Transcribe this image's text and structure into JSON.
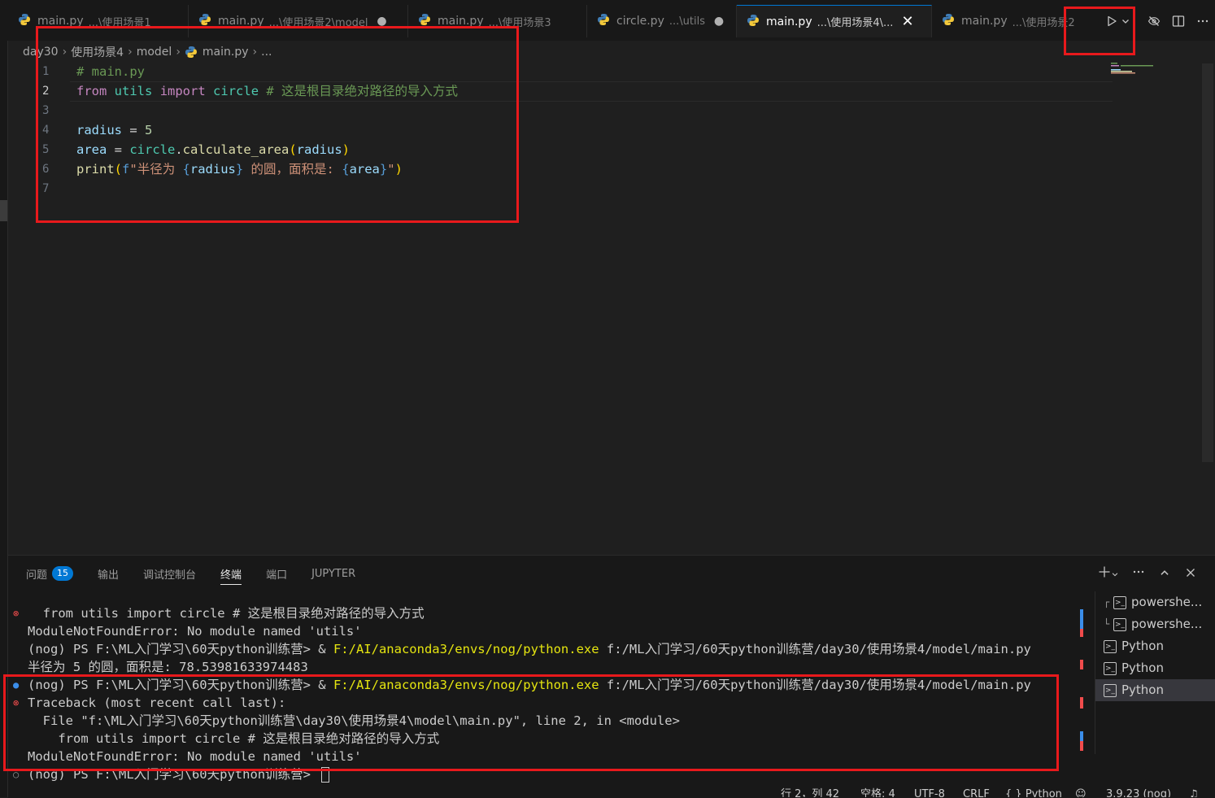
{
  "tabs": [
    {
      "name": "main.py",
      "desc": "...\\使用场景1",
      "mark": ""
    },
    {
      "name": "main.py",
      "desc": "...\\使用场景2\\model",
      "mark": "●"
    },
    {
      "name": "main.py",
      "desc": "...\\使用场景3",
      "mark": ""
    },
    {
      "name": "circle.py",
      "desc": "...\\utils",
      "mark": "●"
    },
    {
      "name": "main.py",
      "desc": "...\\使用场景4\\...",
      "mark": "✕"
    },
    {
      "name": "main.py",
      "desc": "...\\使用场景2",
      "mark": ""
    }
  ],
  "breadcrumb": {
    "items": [
      "day30",
      "使用场景4",
      "model"
    ],
    "file": "main.py",
    "tail": "..."
  },
  "editor": {
    "line_numbers": [
      "1",
      "2",
      "3",
      "4",
      "5",
      "6",
      "7"
    ],
    "current_line": "2",
    "code": {
      "l1": "# main.py",
      "l2_from": "from",
      "l2_module": "utils",
      "l2_import": "import",
      "l2_name": "circle",
      "l2_comment": "# 这是根目录绝对路径的导入方式",
      "l4_var": "radius",
      "l4_eq": " = ",
      "l4_num": "5",
      "l5_var": "area",
      "l5_eq": " = ",
      "l5_obj": "circle",
      "l5_dot": ".",
      "l5_fn": "calculate_area",
      "l5_open": "(",
      "l5_arg": "radius",
      "l5_close": ")",
      "l6_fn": "print",
      "l6_open": "(",
      "l6_fpre": "f",
      "l6_str1": "\"半径为 ",
      "l6_b1o": "{",
      "l6_v1": "radius",
      "l6_b1c": "}",
      "l6_str2": " 的圆，面积是: ",
      "l6_b2o": "{",
      "l6_v2": "area",
      "l6_b2c": "}",
      "l6_str3": "\"",
      "l6_close": ")"
    }
  },
  "panel": {
    "tabs": [
      {
        "label": "问题",
        "badge": "15"
      },
      {
        "label": "输出"
      },
      {
        "label": "调试控制台"
      },
      {
        "label": "终端"
      },
      {
        "label": "端口"
      },
      {
        "label": "JUPYTER"
      }
    ],
    "active_tab": "终端",
    "terminal_lines": {
      "t1": "  from utils import circle # 这是根目录绝对路径的导入方式",
      "t2": "ModuleNotFoundError: No module named 'utils'",
      "t3_prompt": "(nog) PS F:\\ML入门学习\\60天python训练营> & ",
      "t3_exe": "F:/AI/anaconda3/envs/nog/python.exe",
      "t3_arg": " f:/ML入门学习/60天python训练营/day30/使用场景4/model/main.py",
      "t4": "半径为 5 的圆，面积是: 78.53981633974483",
      "t5_prompt": "(nog) PS F:\\ML入门学习\\60天python训练营> & ",
      "t5_exe": "F:/AI/anaconda3/envs/nog/python.exe",
      "t5_arg": " f:/ML入门学习/60天python训练营/day30/使用场景4/model/main.py",
      "t6": "Traceback (most recent call last):",
      "t7": "  File \"f:\\ML入门学习\\60天python训练营\\day30\\使用场景4\\model\\main.py\", line 2, in <module>",
      "t8": "    from utils import circle # 这是根目录绝对路径的导入方式",
      "t9": "ModuleNotFoundError: No module named 'utils'",
      "t10": "(nog) PS F:\\ML入门学习\\60天python训练营> "
    },
    "terminal_instances": [
      {
        "tree": "┌",
        "label": "powershe..."
      },
      {
        "tree": "└",
        "label": "powershe..."
      },
      {
        "tree": "",
        "label": "Python"
      },
      {
        "tree": "",
        "label": "Python"
      },
      {
        "tree": "",
        "label": "Python"
      }
    ]
  },
  "statusbar": {
    "position": "行 2，列 42",
    "spaces": "空格: 4",
    "encoding": "UTF-8",
    "eol": "CRLF",
    "language": "Python",
    "interpreter": "3.9.23 (nog)"
  },
  "colors": {
    "accent": "#0078d4",
    "annotation": "#e8191c",
    "error": "#f14c4c"
  }
}
